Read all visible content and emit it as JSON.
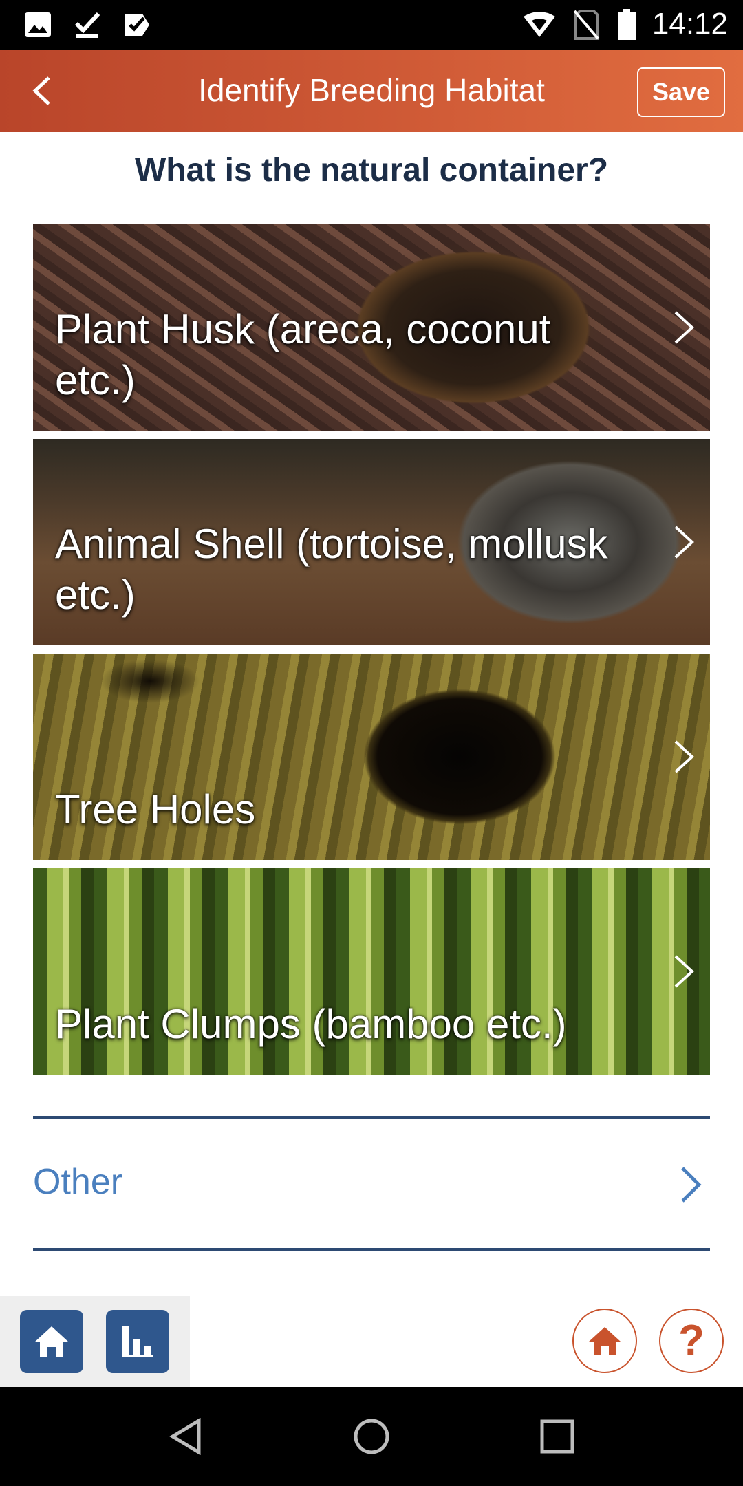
{
  "status_bar": {
    "time": "14:12",
    "left_icons": [
      "image-icon",
      "download-done-icon",
      "check-badge-icon"
    ],
    "right_icons": [
      "wifi-icon",
      "no-sim-icon",
      "battery-icon"
    ]
  },
  "app_bar": {
    "title": "Identify Breeding Habitat",
    "save_label": "Save",
    "back_icon": "chevron-left-icon",
    "color": "#c9532d"
  },
  "question": "What is the natural container?",
  "options": [
    {
      "label": "Plant Husk (areca, coconut etc.)"
    },
    {
      "label": "Animal Shell (tortoise, mollusk etc.)"
    },
    {
      "label": "Tree Holes"
    },
    {
      "label": "Plant Clumps (bamboo etc.)"
    }
  ],
  "other": {
    "label": "Other",
    "color": "#4a7fbe"
  },
  "bottom_toolbar": {
    "left_buttons": [
      "home-icon",
      "bar-chart-icon"
    ],
    "right_buttons": [
      "home-icon",
      "help-icon"
    ],
    "help_glyph": "?",
    "primary_color": "#2f578d"
  },
  "nav_bar": {
    "buttons": [
      "back-icon",
      "home-icon",
      "recents-icon"
    ]
  }
}
